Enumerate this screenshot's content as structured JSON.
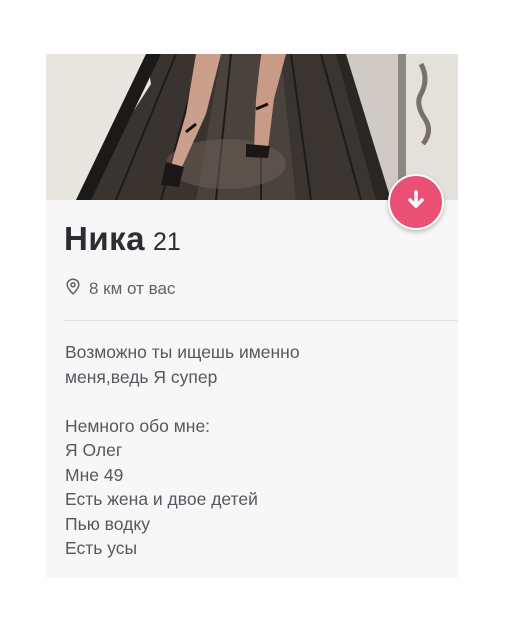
{
  "profile": {
    "name": "Ника",
    "age": "21",
    "distance": "8 км от вас",
    "bio_lines": [
      "Возможно ты ищешь именно",
      "меня,ведь Я супер",
      "",
      "Немного обо мне:",
      "Я Олег",
      "Мне 49",
      "Есть жена и двое детей",
      "Пью водку",
      "Есть усы"
    ]
  },
  "icons": {
    "expand": "arrow-down-icon",
    "location": "location-pin-icon"
  },
  "colors": {
    "accent": "#ea4f74",
    "name_text": "#2b2d33",
    "secondary_text": "#5f626a",
    "card_bg": "#f7f7f7"
  }
}
